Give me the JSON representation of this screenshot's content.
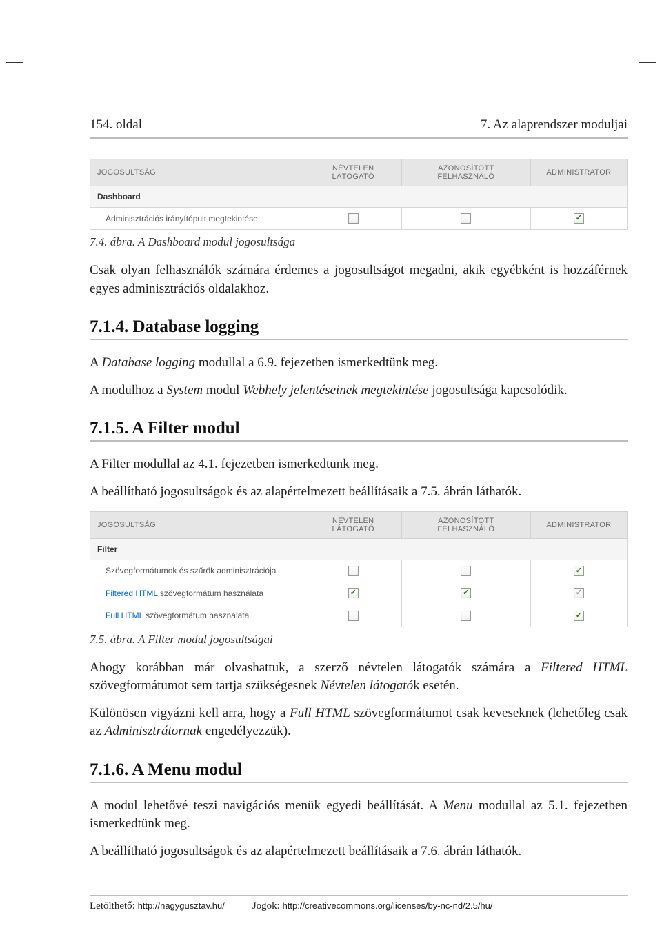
{
  "header": {
    "page_left": "154. oldal",
    "page_right": "7. Az alaprendszer moduljai"
  },
  "table1": {
    "headers": [
      "JOGOSULTSÁG",
      "NÉVTELEN LÁTOGATÓ",
      "AZONOSÍTOTT FELHASZNÁLÓ",
      "ADMINISTRATOR"
    ],
    "section": "Dashboard",
    "rows": [
      {
        "label": "Adminisztrációs irányítópult megtekintése",
        "cells": [
          "empty",
          "empty",
          "checked"
        ]
      }
    ]
  },
  "caption1": "7.4. ábra. A Dashboard modul jogosultsága",
  "para1_a": "Csak olyan felhasználók számára érdemes a jogosultságot megadni, akik egyébként is hoz­záférnek egyes adminisztrációs oldalakhoz.",
  "sec714": {
    "title": "7.1.4. Database logging",
    "p1_prefix": "A ",
    "p1_em": "Database logging",
    "p1_suffix": " modullal a 6.9. fejezetben ismerkedtünk meg.",
    "p2_a": "A modulhoz a ",
    "p2_em1": "System",
    "p2_b": " modul ",
    "p2_em2": "Webhely jelentéseinek megtekintése",
    "p2_c": " jogosultsága kapcsolódik."
  },
  "sec715": {
    "title": "7.1.5. A Filter modul",
    "p1": "A Filter modullal az 4.1. fejezetben ismerkedtünk meg.",
    "p2": "A beállítható jogosultságok és az alapértelmezett beállításaik a 7.5. ábrán láthatók."
  },
  "table2": {
    "headers": [
      "JOGOSULTSÁG",
      "NÉVTELEN LÁTOGATÓ",
      "AZONOSÍTOTT FELHASZNÁLÓ",
      "ADMINISTRATOR"
    ],
    "section": "Filter",
    "rows": [
      {
        "label": "Szövegformátumok és szűrők adminisztrációja",
        "link": null,
        "cells": [
          "empty",
          "empty",
          "checked"
        ]
      },
      {
        "label_link": "Filtered HTML",
        "label_rest": " szövegformátum használata",
        "cells": [
          "checked",
          "checked",
          "checked-gray"
        ]
      },
      {
        "label_link": "Full HTML",
        "label_rest": " szövegformátum használata",
        "cells": [
          "empty",
          "empty",
          "checked"
        ]
      }
    ]
  },
  "caption2": "7.5. ábra. A Filter modul jogosultságai",
  "para715c_a": "Ahogy korábban már olvashattuk, a szerző névtelen látogatók számára a ",
  "para715c_em1": "Filtered HTML",
  "para715c_b": " szövegformátumot sem tartja szükségesnek ",
  "para715c_em2": "Névtelen látogató",
  "para715c_c": "k esetén.",
  "para715d_a": "Különösen vigyázni kell arra, hogy a ",
  "para715d_em1": "Full HTML",
  "para715d_b": " szövegformátumot csak keveseknek (lehe­tőleg csak az ",
  "para715d_em2": "Adminisztrátornak",
  "para715d_c": " engedélyezzük).",
  "sec716": {
    "title": "7.1.6. A Menu modul",
    "p1_a": "A modul lehetővé teszi navigációs menük egyedi beállítását. A ",
    "p1_em": "Menu",
    "p1_b": " modullal az 5.1. feje­zetben ismerkedtünk meg.",
    "p2": "A beállítható jogosultságok és az alapértelmezett beállításaik a 7.6. ábrán láthatók."
  },
  "footer": {
    "dl_label": "Letölthető: ",
    "dl_url": "http://nagygusztav.hu/",
    "rights_label": "Jogok: ",
    "rights_url": "http://creativecommons.org/licenses/by-nc-nd/2.5/hu/"
  }
}
